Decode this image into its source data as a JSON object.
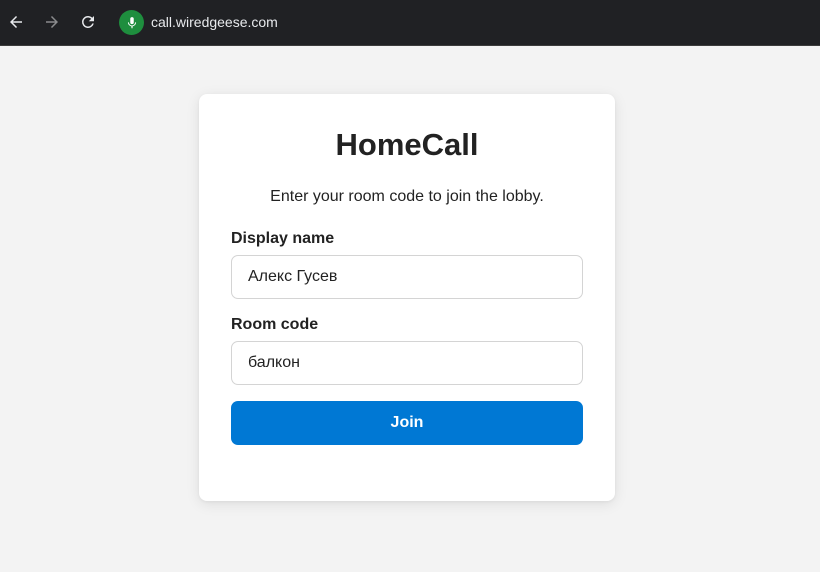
{
  "browser": {
    "url": "call.wiredgeese.com",
    "back_icon": "arrow-left-icon",
    "forward_icon": "arrow-right-icon",
    "reload_icon": "reload-icon",
    "site_indicator_icon": "microphone-icon",
    "site_indicator_color": "#1e8e3e"
  },
  "card": {
    "title": "HomeCall",
    "subtitle": "Enter your room code to join the lobby.",
    "display_name": {
      "label": "Display name",
      "value": "Алекс Гусев"
    },
    "room_code": {
      "label": "Room code",
      "value": "балкон"
    },
    "join_label": "Join",
    "accent_color": "#0078d4"
  }
}
